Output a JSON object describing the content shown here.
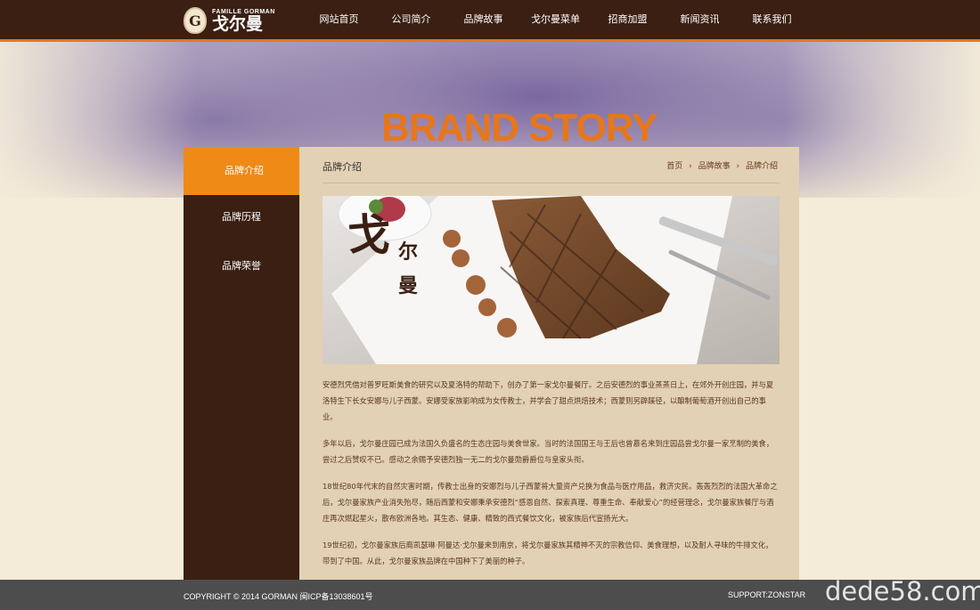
{
  "header": {
    "logo_sub": "FAMILLE GORMAN",
    "logo_main": "戈尔曼",
    "logo_badge": "G",
    "nav": [
      {
        "label": "网站首页"
      },
      {
        "label": "公司简介"
      },
      {
        "label": "品牌故事"
      },
      {
        "label": "戈尔曼菜单"
      },
      {
        "label": "招商加盟"
      },
      {
        "label": "新闻资讯"
      },
      {
        "label": "联系我们"
      }
    ],
    "active_nav": "品牌故事"
  },
  "banner": {
    "title": "BRAND STORY"
  },
  "sidebar": {
    "items": [
      {
        "label": "品牌介绍"
      },
      {
        "label": "品牌历程"
      },
      {
        "label": "品牌荣誉"
      }
    ]
  },
  "main": {
    "section_title": "品牌介绍",
    "breadcrumb": [
      "首页",
      "品牌故事",
      "品牌介绍"
    ],
    "hero_text": {
      "big1": "戈",
      "big2": "尔",
      "big3": "曼"
    },
    "paragraphs": [
      "安德烈凭借对普罗旺斯美食的研究以及夏洛特的帮助下，创办了第一家戈尔曼餐厅。之后安德烈的事业蒸蒸日上，在郊外开创庄园，并与夏洛特生下长女安娜与儿子西蒙。安娜受家族影响成为女传教士，并学会了甜点烘焙技术；西蒙则另辟蹊径，以酿制葡萄酒开创出自己的事业。",
      "多年以后，戈尔曼庄园已成为法国久负盛名的生态庄园与美食世家。当时的法国国王与王后也曾慕名来到庄园品尝戈尔曼一家烹制的美食，尝过之后赞叹不已。感动之余赐予安德烈独一无二的戈尔曼勋爵爵位与皇家头衔。",
      "18世纪80年代末的自然灾害时期，传教士出身的安娜烈与儿子西蒙将大量资产兑换为食品与医疗用品，救济灾民。轰轰烈烈的法国大革命之后，戈尔曼家族产业消失殆尽，随后西蒙和安娜秉承安德烈“感恩自然、探索真理、尊重生命、奉献爱心”的经营理念，戈尔曼家族餐厅与酒庄再次燃起星火，散布欧洲各地。其生态、健康、精致的西式餐饮文化，被家族后代宣扬光大。",
      "19世纪初，戈尔曼家族后裔凯瑟琳·阿曼达·戈尔曼来到南京，将戈尔曼家族其精神不灭的宗教信仰、美食理想，以及耐人寻味的牛排文化，带到了中国。从此，戈尔曼家族品牌在中国种下了美丽的种子。"
    ]
  },
  "footer": {
    "copyright": "COPYRIGHT © 2014  GORMAN  闽ICP备13038601号",
    "support": "SUPPORT:ZONSTAR"
  },
  "watermark": "dede58.com",
  "colors": {
    "header_bg": "#3a1f12",
    "accent": "#e8761a",
    "sidebar_bg": "#3a1f12",
    "content_bg": "#e2d1b4",
    "footer_bg": "#4d4d4d"
  }
}
